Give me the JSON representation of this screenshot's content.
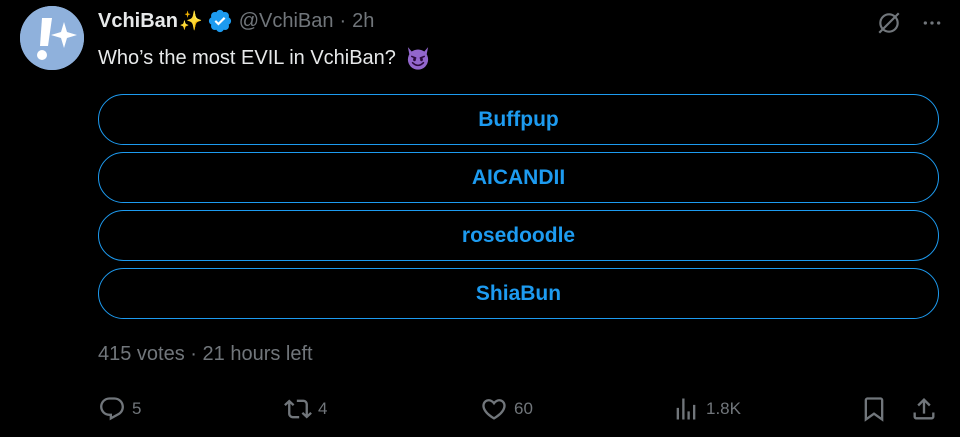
{
  "tweet": {
    "author_name": "VchiBan",
    "name_emoji": "✨",
    "handle": "@VchiBan",
    "separator": "·",
    "time": "2h",
    "text": "Who’s the most EVIL in VchiBan?",
    "text_emoji": "smiling-imp-emoji"
  },
  "poll": {
    "options": [
      "Buffpup",
      "AICANDII",
      "rosedoodle",
      "ShiaBun"
    ],
    "votes": "415 votes",
    "meta_separator": "·",
    "time_left": "21 hours left"
  },
  "actions": {
    "replies": "5",
    "retweets": "4",
    "likes": "60",
    "views": "1.8K"
  },
  "colors": {
    "accent": "#1d9bf0",
    "muted": "#71767b",
    "text": "#e7e9ea",
    "avatar": "#8fb1dc"
  }
}
